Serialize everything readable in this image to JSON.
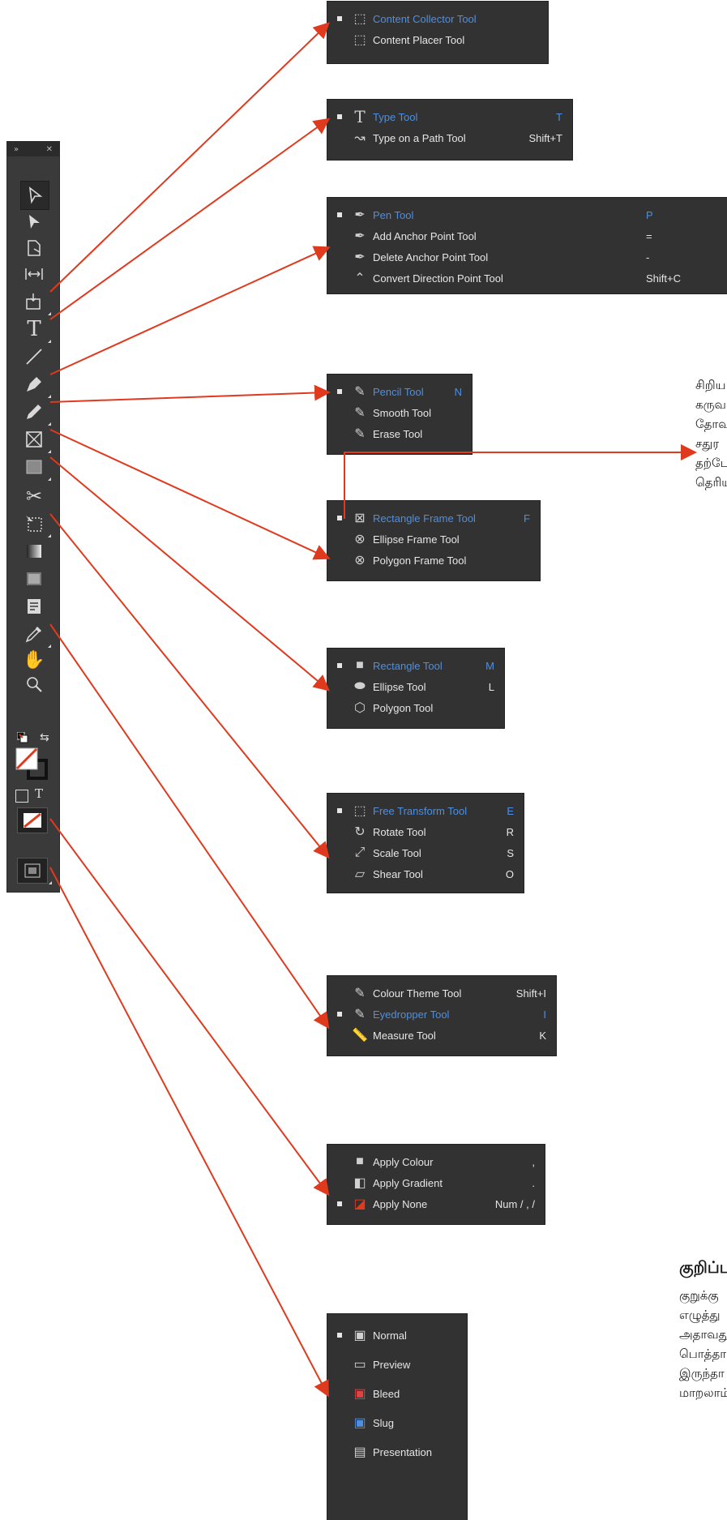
{
  "toolbar": {
    "header_left": "»",
    "header_right": "✕",
    "mode_letter": "T"
  },
  "flyouts": {
    "content": [
      {
        "label": "Content Collector Tool",
        "key": "",
        "active": true
      },
      {
        "label": "Content Placer Tool",
        "key": "",
        "active": false
      }
    ],
    "type": [
      {
        "label": "Type Tool",
        "key": "T",
        "active": true
      },
      {
        "label": "Type on a Path Tool",
        "key": "Shift+T",
        "active": false
      }
    ],
    "pen": [
      {
        "label": "Pen Tool",
        "key": "P",
        "active": true
      },
      {
        "label": "Add Anchor Point Tool",
        "key": "=",
        "active": false
      },
      {
        "label": "Delete Anchor Point Tool",
        "key": "-",
        "active": false
      },
      {
        "label": "Convert Direction Point Tool",
        "key": "Shift+C",
        "active": false
      }
    ],
    "pencil": [
      {
        "label": "Pencil Tool",
        "key": "N",
        "active": true
      },
      {
        "label": "Smooth Tool",
        "key": "",
        "active": false
      },
      {
        "label": "Erase Tool",
        "key": "",
        "active": false
      }
    ],
    "frame": [
      {
        "label": "Rectangle Frame Tool",
        "key": "F",
        "active": true
      },
      {
        "label": "Ellipse Frame Tool",
        "key": "",
        "active": false
      },
      {
        "label": "Polygon Frame Tool",
        "key": "",
        "active": false
      }
    ],
    "shape": [
      {
        "label": "Rectangle Tool",
        "key": "M",
        "active": true
      },
      {
        "label": "Ellipse Tool",
        "key": "L",
        "active": false
      },
      {
        "label": "Polygon Tool",
        "key": "",
        "active": false
      }
    ],
    "transform": [
      {
        "label": "Free Transform Tool",
        "key": "E",
        "active": true
      },
      {
        "label": "Rotate Tool",
        "key": "R",
        "active": false
      },
      {
        "label": "Scale Tool",
        "key": "S",
        "active": false
      },
      {
        "label": "Shear Tool",
        "key": "O",
        "active": false
      }
    ],
    "eyedropper": [
      {
        "label": "Colour Theme Tool",
        "key": "Shift+I",
        "active": false
      },
      {
        "label": "Eyedropper Tool",
        "key": "I",
        "active": true
      },
      {
        "label": "Measure Tool",
        "key": "K",
        "active": false
      }
    ],
    "apply": [
      {
        "label": "Apply Colour",
        "key": ",",
        "active": false
      },
      {
        "label": "Apply Gradient",
        "key": ".",
        "active": false
      },
      {
        "label": "Apply None",
        "key": "Num / , /",
        "active": false
      }
    ],
    "screen": [
      {
        "label": "Normal",
        "key": "",
        "active": false
      },
      {
        "label": "Preview",
        "key": "",
        "active": false
      },
      {
        "label": "Bleed",
        "key": "",
        "active": false
      },
      {
        "label": "Slug",
        "key": "",
        "active": false
      },
      {
        "label": "Presentation",
        "key": "",
        "active": false
      }
    ]
  },
  "side_text": {
    "lines": [
      "சிறிய",
      "கருவ",
      "தோவ",
      "சதுர",
      "தற்டே",
      "தெரிய"
    ]
  },
  "note": {
    "heading": "குறிப்பு",
    "lines": [
      "குறுக்கு",
      "எழுத்து",
      "அதாவது",
      "பொத்தா",
      "இருந்தா",
      "மாறலாம்"
    ]
  },
  "colors": {
    "panel": "#323232",
    "active_text": "#4e8fe0",
    "arrow": "#e03a1e"
  }
}
